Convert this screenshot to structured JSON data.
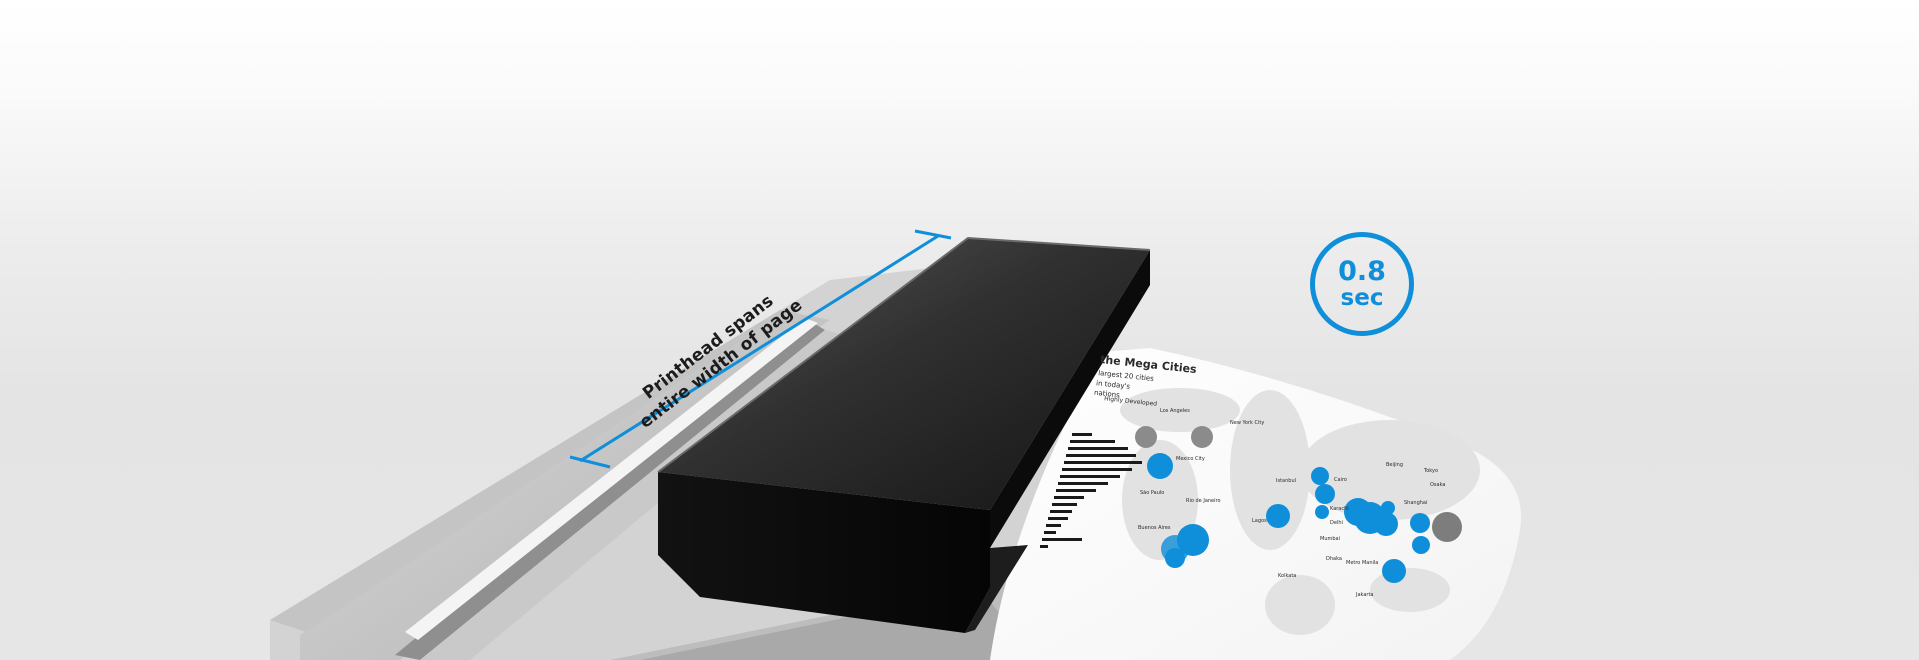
{
  "annotation": {
    "line1": "Printhead spans",
    "line2": "entire width of page"
  },
  "badge": {
    "value": "0.8",
    "unit": "sec"
  },
  "printed_page": {
    "title": "the Mega Cities",
    "subtitle_lines": [
      "largest 20 cities",
      "in today's",
      "nations"
    ],
    "legend": "Highly Developed",
    "cities": [
      "Los Angeles",
      "New York City",
      "Mexico City",
      "São Paulo",
      "Rio de Janeiro",
      "Buenos Aires",
      "Istanbul",
      "Lagos",
      "Cairo",
      "Karachi",
      "Delhi",
      "Mumbai",
      "Dhaka",
      "Kolkata",
      "Shanghai",
      "Beijing",
      "Tokyo",
      "Osaka",
      "Metro Manila",
      "Jakarta"
    ]
  },
  "colors": {
    "accent": "#0f8fd9",
    "printhead": "#111111",
    "background": "#e6e6e6"
  }
}
